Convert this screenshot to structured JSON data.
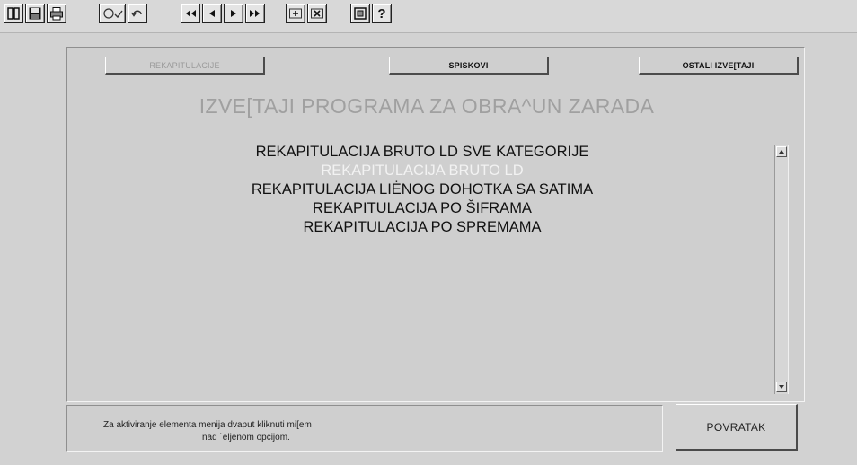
{
  "toolbar": {
    "groups": [
      [
        "book-icon",
        "save-icon",
        "print-icon"
      ],
      [
        "spellcheck-icon",
        "undo-icon"
      ],
      [
        "first-record-icon",
        "previous-record-icon",
        "next-record-icon",
        "last-record-icon"
      ],
      [
        "new-record-icon",
        "delete-record-icon"
      ],
      [
        "window-icon",
        "help-icon"
      ]
    ],
    "help_label": "?"
  },
  "tabs": {
    "recaps": "REKAPITULACIJE",
    "lists": "SPISKOVI",
    "other": "OSTALI IZVE[TAJI"
  },
  "heading": "IZVE[TAJI PROGRAMA ZA OBRA^UN ZARADA",
  "report_list": {
    "items": [
      "REKAPITULACIJA BRUTO LD SVE KATEGORIJE",
      "REKAPITULACIJA BRUTO LD",
      "REKAPITULACIJA LIĖNOG DOHOTKA SA SATIMA",
      "REKAPITULACIJA PO ŠIFRAMA",
      "REKAPITULACIJA PO SPREMAMA"
    ],
    "selected_index": 1
  },
  "hint": {
    "line1": "Za aktiviranje elementa menija dvaput kliknuti mi[em",
    "line2": "nad `eljenom opcijom."
  },
  "back_button": "POVRATAK",
  "colors": {
    "background": "#d2d2d2",
    "heading": "#a0a0a0",
    "selected_item": "#f2f2f2",
    "item": "#111111"
  }
}
